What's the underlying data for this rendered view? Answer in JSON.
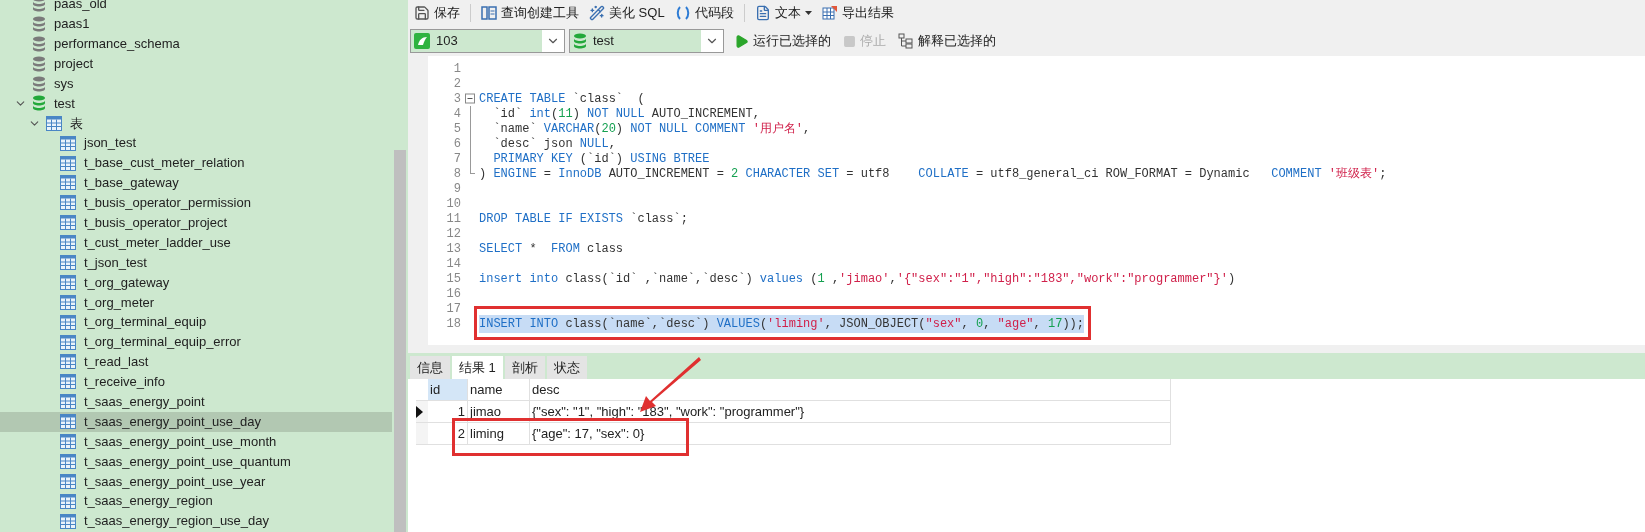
{
  "sidebar": {
    "items": [
      {
        "label": "paas_old",
        "kind": "database",
        "expanded": false,
        "selected": false
      },
      {
        "label": "paas1",
        "kind": "database",
        "expanded": false,
        "selected": false
      },
      {
        "label": "performance_schema",
        "kind": "database",
        "expanded": false,
        "selected": false
      },
      {
        "label": "project",
        "kind": "database",
        "expanded": false,
        "selected": false
      },
      {
        "label": "sys",
        "kind": "database",
        "expanded": false,
        "selected": false
      },
      {
        "label": "test",
        "kind": "database",
        "expanded": true,
        "selected": false,
        "children": [
          {
            "label": "表",
            "kind": "folder",
            "expanded": true,
            "selected": false,
            "children": [
              {
                "label": "json_test",
                "kind": "table",
                "selected": false
              },
              {
                "label": "t_base_cust_meter_relation",
                "kind": "table",
                "selected": false
              },
              {
                "label": "t_base_gateway",
                "kind": "table",
                "selected": false
              },
              {
                "label": "t_busis_operator_permission",
                "kind": "table",
                "selected": false
              },
              {
                "label": "t_busis_operator_project",
                "kind": "table",
                "selected": false
              },
              {
                "label": "t_cust_meter_ladder_use",
                "kind": "table",
                "selected": false
              },
              {
                "label": "t_json_test",
                "kind": "table",
                "selected": false
              },
              {
                "label": "t_org_gateway",
                "kind": "table",
                "selected": false
              },
              {
                "label": "t_org_meter",
                "kind": "table",
                "selected": false
              },
              {
                "label": "t_org_terminal_equip",
                "kind": "table",
                "selected": false
              },
              {
                "label": "t_org_terminal_equip_error",
                "kind": "table",
                "selected": false
              },
              {
                "label": "t_read_last",
                "kind": "table",
                "selected": false
              },
              {
                "label": "t_receive_info",
                "kind": "table",
                "selected": false
              },
              {
                "label": "t_saas_energy_point",
                "kind": "table",
                "selected": false
              },
              {
                "label": "t_saas_energy_point_use_day",
                "kind": "table",
                "selected": true
              },
              {
                "label": "t_saas_energy_point_use_month",
                "kind": "table",
                "selected": false
              },
              {
                "label": "t_saas_energy_point_use_quantum",
                "kind": "table",
                "selected": false
              },
              {
                "label": "t_saas_energy_point_use_year",
                "kind": "table",
                "selected": false
              },
              {
                "label": "t_saas_energy_region",
                "kind": "table",
                "selected": false
              },
              {
                "label": "t_saas_energy_region_use_day",
                "kind": "table",
                "selected": false
              }
            ]
          }
        ]
      }
    ]
  },
  "toolbar": [
    {
      "label": "保存"
    },
    {
      "label": "查询创建工具"
    },
    {
      "label": "美化 SQL"
    },
    {
      "label": "代码段"
    },
    {
      "label": "文本",
      "dropdown": true
    },
    {
      "label": "导出结果"
    }
  ],
  "connection": {
    "value": "103"
  },
  "database": {
    "value": "test"
  },
  "actions": [
    {
      "label": "运行已选择的",
      "disabled": false
    },
    {
      "label": "停止",
      "disabled": true
    },
    {
      "label": "解释已选择的",
      "disabled": false
    }
  ],
  "editor": {
    "lines": [
      {
        "number": "1"
      },
      {
        "number": "2"
      },
      {
        "number": "3",
        "fold_expanded": true,
        "tokens": [
          {
            "kind": "kw",
            "text": "CREATE TABLE"
          },
          {
            "kind": "plain",
            "text": " `class`  ("
          }
        ]
      },
      {
        "number": "4",
        "in_fold": true,
        "tokens": [
          {
            "kind": "plain",
            "text": "  `id` "
          },
          {
            "kind": "kw",
            "text": "int"
          },
          {
            "kind": "plain",
            "text": "("
          },
          {
            "kind": "num",
            "text": "11"
          },
          {
            "kind": "plain",
            "text": ") "
          },
          {
            "kind": "kw",
            "text": "NOT NULL"
          },
          {
            "kind": "plain",
            "text": " AUTO_INCREMENT,"
          }
        ]
      },
      {
        "number": "5",
        "in_fold": true,
        "tokens": [
          {
            "kind": "plain",
            "text": "  `name` "
          },
          {
            "kind": "kw",
            "text": "VARCHAR"
          },
          {
            "kind": "plain",
            "text": "("
          },
          {
            "kind": "num",
            "text": "20"
          },
          {
            "kind": "plain",
            "text": ") "
          },
          {
            "kind": "kw",
            "text": "NOT NULL COMMENT "
          },
          {
            "kind": "str",
            "text": "'用户名'"
          },
          {
            "kind": "plain",
            "text": ","
          }
        ]
      },
      {
        "number": "6",
        "in_fold": true,
        "tokens": [
          {
            "kind": "plain",
            "text": "  `desc` json "
          },
          {
            "kind": "kw",
            "text": "NULL"
          },
          {
            "kind": "plain",
            "text": ","
          }
        ]
      },
      {
        "number": "7",
        "in_fold": true,
        "tokens": [
          {
            "kind": "kw",
            "text": "  PRIMARY KEY"
          },
          {
            "kind": "plain",
            "text": " (`id`) "
          },
          {
            "kind": "kw",
            "text": "USING BTREE"
          }
        ]
      },
      {
        "number": "8",
        "in_fold": true,
        "tokens": [
          {
            "kind": "plain",
            "text": ") "
          },
          {
            "kind": "kw",
            "text": "ENGINE"
          },
          {
            "kind": "plain",
            "text": " = "
          },
          {
            "kind": "kw",
            "text": "InnoDB"
          },
          {
            "kind": "plain",
            "text": " AUTO_INCREMENT = "
          },
          {
            "kind": "num",
            "text": "2"
          },
          {
            "kind": "kw",
            "text": " CHARACTER SET"
          },
          {
            "kind": "plain",
            "text": " = utf8    "
          },
          {
            "kind": "kw",
            "text": "COLLATE"
          },
          {
            "kind": "plain",
            "text": " = utf8_general_ci ROW_FORMAT = Dynamic   "
          },
          {
            "kind": "kw",
            "text": "COMMENT "
          },
          {
            "kind": "str",
            "text": "'班级表'"
          },
          {
            "kind": "plain",
            "text": ";"
          }
        ]
      },
      {
        "number": "9"
      },
      {
        "number": "10"
      },
      {
        "number": "11",
        "tokens": [
          {
            "kind": "kw",
            "text": "DROP TABLE IF EXISTS"
          },
          {
            "kind": "plain",
            "text": " `class`;"
          }
        ]
      },
      {
        "number": "12"
      },
      {
        "number": "13",
        "tokens": [
          {
            "kind": "kw",
            "text": "SELECT"
          },
          {
            "kind": "plain",
            "text": " *  "
          },
          {
            "kind": "kw",
            "text": "FROM"
          },
          {
            "kind": "plain",
            "text": " class"
          }
        ]
      },
      {
        "number": "14"
      },
      {
        "number": "15",
        "tokens": [
          {
            "kind": "kw",
            "text": "insert into"
          },
          {
            "kind": "plain",
            "text": " class(`id` ,`name`,`desc`) "
          },
          {
            "kind": "kw",
            "text": "values"
          },
          {
            "kind": "plain",
            "text": " ("
          },
          {
            "kind": "num",
            "text": "1"
          },
          {
            "kind": "plain",
            "text": " ,"
          },
          {
            "kind": "str",
            "text": "'jimao'"
          },
          {
            "kind": "plain",
            "text": ","
          },
          {
            "kind": "str",
            "text": "'{\"sex\":\"1\",\"high\":\"183\",\"work\":\"programmer\"}'"
          },
          {
            "kind": "plain",
            "text": ")"
          }
        ]
      },
      {
        "number": "16"
      },
      {
        "number": "17"
      },
      {
        "number": "18",
        "selected": true,
        "tokens": [
          {
            "kind": "kw",
            "text": "INSERT INTO"
          },
          {
            "kind": "plain",
            "text": " class(`name`,`desc`) "
          },
          {
            "kind": "kw",
            "text": "VALUES"
          },
          {
            "kind": "plain",
            "text": "("
          },
          {
            "kind": "str",
            "text": "'liming'"
          },
          {
            "kind": "plain",
            "text": ", JSON_OBJECT("
          },
          {
            "kind": "str",
            "text": "\"sex\""
          },
          {
            "kind": "plain",
            "text": ", "
          },
          {
            "kind": "num",
            "text": "0"
          },
          {
            "kind": "plain",
            "text": ", "
          },
          {
            "kind": "str",
            "text": "\"age\""
          },
          {
            "kind": "plain",
            "text": ", "
          },
          {
            "kind": "num",
            "text": "17"
          },
          {
            "kind": "plain",
            "text": "));"
          }
        ]
      }
    ]
  },
  "result_tabs": [
    {
      "label": "信息",
      "selected": false
    },
    {
      "label": "结果 1",
      "selected": true
    },
    {
      "label": "剖析",
      "selected": false
    },
    {
      "label": "状态",
      "selected": false
    }
  ],
  "grid": {
    "columns": [
      {
        "label": "id",
        "selected": true
      },
      {
        "label": "name",
        "selected": false
      },
      {
        "label": "desc",
        "selected": false
      }
    ],
    "rows": [
      {
        "current": true,
        "cells": [
          "1",
          "jimao",
          "{\"sex\": \"1\", \"high\": \"183\", \"work\": \"programmer\"}"
        ]
      },
      {
        "current": false,
        "cells": [
          "2",
          "liming",
          "{\"age\": 17, \"sex\": 0}"
        ]
      }
    ]
  }
}
